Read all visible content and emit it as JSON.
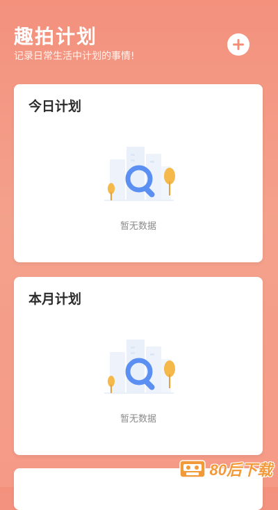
{
  "header": {
    "title": "趣拍计划",
    "subtitle": "记录日常生活中计划的事情!",
    "add_icon": "plus-icon"
  },
  "cards": [
    {
      "title": "今日计划",
      "empty_text": "暂无数据",
      "icon": "empty-search-illustration"
    },
    {
      "title": "本月计划",
      "empty_text": "暂无数据",
      "icon": "empty-search-illustration"
    }
  ],
  "watermark": {
    "text": "80后下载",
    "icon": "cassette-logo-icon"
  },
  "colors": {
    "background_top": "#f3917d",
    "background_bottom": "#f59a86",
    "card": "#ffffff",
    "accent_blue": "#5b8ff2",
    "tree_orange": "#f5b84a",
    "watermark": "#f29a3a"
  }
}
